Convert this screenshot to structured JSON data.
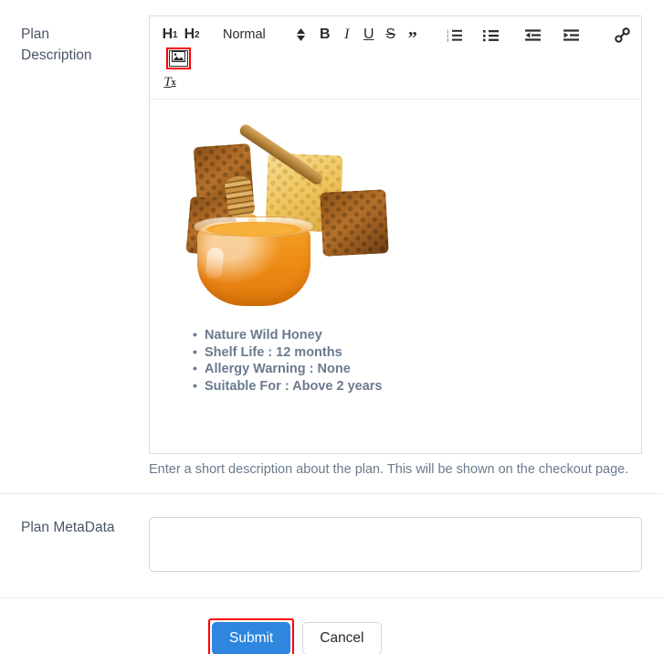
{
  "form": {
    "description_label": "Plan Description",
    "description_label_line1": "Plan",
    "description_label_line2": "Description",
    "metadata_label": "Plan MetaData",
    "metadata_value": "",
    "metadata_placeholder": "",
    "help_text": "Enter a short description about the plan. This will be shown on the checkout page."
  },
  "editor": {
    "toolbar": {
      "h1": "H",
      "h1_sub": "1",
      "h2": "H",
      "h2_sub": "2",
      "format_selected": "Normal",
      "bold": "B",
      "italic": "I",
      "underline": "U",
      "strike": "S",
      "blockquote": "”",
      "clear_format": "T",
      "clear_format_sub": "x",
      "icons": {
        "ordered_list": "ordered-list-icon",
        "bullet_list": "bullet-list-icon",
        "outdent": "outdent-icon",
        "indent": "indent-icon",
        "link": "link-icon",
        "image": "image-icon",
        "picker_arrows": "chevron-updown-icon"
      },
      "image_button_highlighted": true,
      "highlight_color": "#ff0000"
    },
    "content": {
      "image_alt": "honey-jar-with-dipper-and-honeycomb",
      "bullets": [
        "Nature Wild Honey",
        "Shelf Life : 12 months",
        "Allergy Warning : None",
        "Suitable For : Above 2 years"
      ]
    }
  },
  "footer": {
    "submit_label": "Submit",
    "cancel_label": "Cancel",
    "submit_highlighted": true,
    "submit_color": "#2e86de",
    "highlight_color": "#ff0000"
  }
}
